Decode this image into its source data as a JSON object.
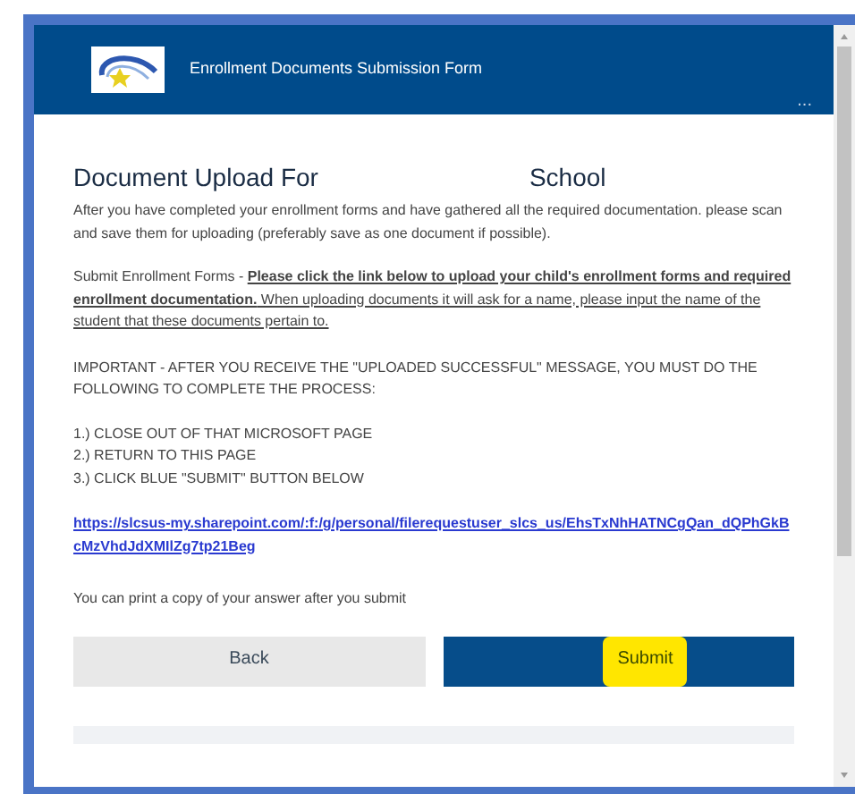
{
  "form_header": {
    "title": "Enrollment Documents Submission Form",
    "more": "..."
  },
  "heading": {
    "before": "Document Upload For",
    "after": "School"
  },
  "intro": "After you have completed your enrollment forms and have gathered all the required documentation. please scan and save them for uploading (preferably save as one document if possible).",
  "instructions": [
    {
      "kind": "plain",
      "text": "Submit Enrollment Forms - "
    },
    {
      "kind": "bold-underline",
      "text": "Please click the link below to upload your child's enrollment forms and required enrollment documentation."
    },
    {
      "kind": "underline",
      "text": " When uploading documents it will ask for a name, please input the name of the student that these documents pertain to."
    }
  ],
  "important": "IMPORTANT - AFTER YOU RECEIVE THE \"UPLOADED SUCCESSFUL\" MESSAGE, YOU MUST DO THE FOLLOWING TO COMPLETE THE PROCESS:",
  "steps": [
    "1.)  CLOSE OUT OF THAT MICROSOFT PAGE",
    "2.)  RETURN TO THIS PAGE",
    "3.)  CLICK BLUE \"SUBMIT\" BUTTON BELOW"
  ],
  "link": "https://slcsus-my.sharepoint.com/:f:/g/personal/filerequestuser_slcs_us/EhsTxNhHATNCgQan_dQPhGkBcMzVhdJdXMIlZg7tp21Beg",
  "print_note": "You can print a copy of your answer after you submit",
  "buttons": [
    {
      "kind": "back",
      "label": "Back",
      "highlighted": false
    },
    {
      "kind": "submit",
      "label": "Submit",
      "highlighted": true
    }
  ]
}
